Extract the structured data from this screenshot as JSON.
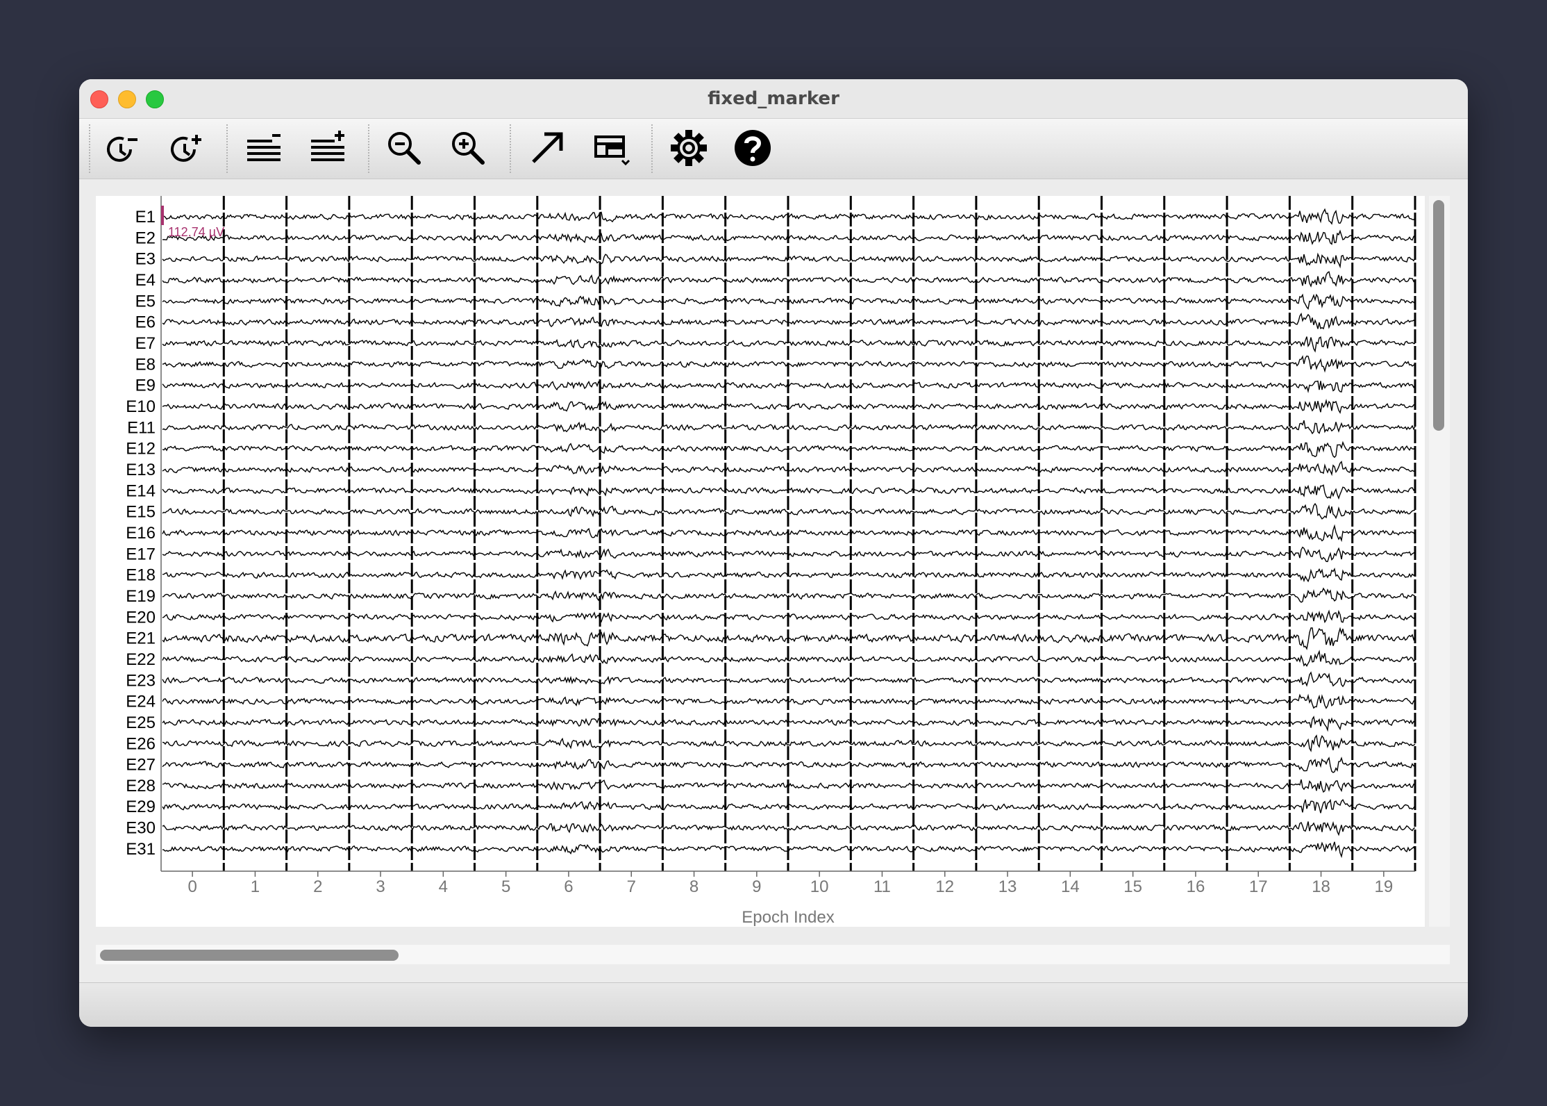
{
  "window": {
    "title": "fixed_marker"
  },
  "toolbar": {
    "buttons": [
      {
        "name": "decrease-duration-button",
        "icon": "clock-minus-icon"
      },
      {
        "name": "increase-duration-button",
        "icon": "clock-plus-icon"
      },
      {
        "name": "decrease-channels-button",
        "icon": "lines-minus-icon"
      },
      {
        "name": "increase-channels-button",
        "icon": "lines-plus-icon"
      },
      {
        "name": "zoom-out-button",
        "icon": "zoom-out-icon"
      },
      {
        "name": "zoom-in-button",
        "icon": "zoom-in-icon"
      },
      {
        "name": "projectors-button",
        "icon": "arrow-icon"
      },
      {
        "name": "overview-button",
        "icon": "layout-icon"
      },
      {
        "name": "settings-button",
        "icon": "gear-icon"
      },
      {
        "name": "help-button",
        "icon": "help-icon"
      }
    ]
  },
  "scalebar": {
    "label": "112.74 µV",
    "color": "#a8326e"
  },
  "chart_data": {
    "type": "line",
    "title": "",
    "xlabel": "Epoch Index",
    "ylabel": "",
    "x_ticks": [
      0,
      1,
      2,
      3,
      4,
      5,
      6,
      7,
      8,
      9,
      10,
      11,
      12,
      13,
      14,
      15,
      16,
      17,
      18,
      19
    ],
    "xlim": [
      -0.5,
      19.5
    ],
    "epoch_boundaries": [
      0.5,
      1.5,
      2.5,
      3.5,
      4.5,
      5.5,
      6.5,
      7.5,
      8.5,
      9.5,
      10.5,
      11.5,
      12.5,
      13.5,
      14.5,
      15.5,
      16.5,
      17.5,
      18.5
    ],
    "channels": [
      "E1",
      "E2",
      "E3",
      "E4",
      "E5",
      "E6",
      "E7",
      "E8",
      "E9",
      "E10",
      "E11",
      "E12",
      "E13",
      "E14",
      "E15",
      "E16",
      "E17",
      "E18",
      "E19",
      "E20",
      "E21",
      "E22",
      "E23",
      "E24",
      "E25",
      "E26",
      "E27",
      "E28",
      "E29",
      "E30",
      "E31"
    ],
    "trace_color": "#000000",
    "grid": false
  }
}
